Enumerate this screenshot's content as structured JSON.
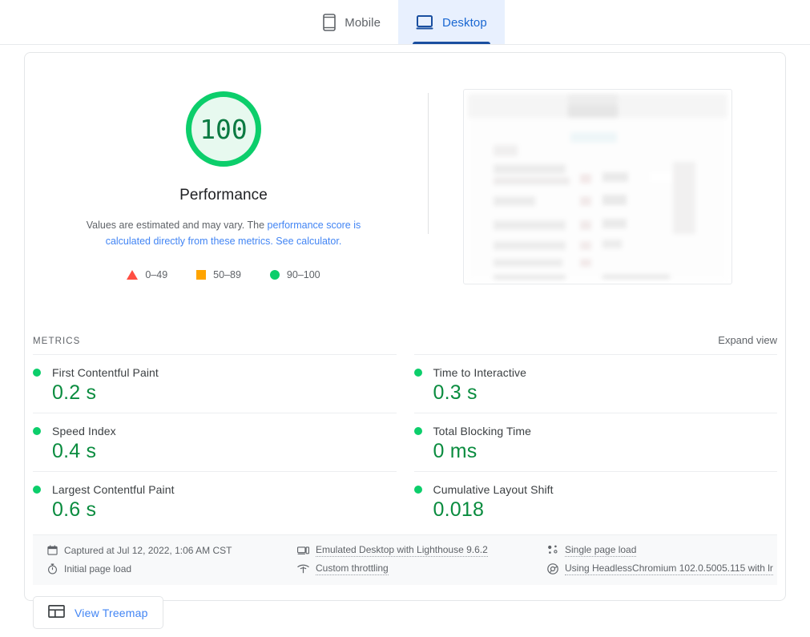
{
  "tabs": [
    {
      "id": "mobile",
      "label": "Mobile",
      "icon": "mobile-phone-icon",
      "active": false
    },
    {
      "id": "desktop",
      "label": "Desktop",
      "icon": "desktop-monitor-icon",
      "active": true
    }
  ],
  "score": {
    "value": "100",
    "title": "Performance",
    "ring_color": "#0cce6b",
    "fill_color": "#e7f9ef",
    "text_color": "#0b7a42",
    "description_before": "Values are estimated and may vary. The ",
    "link_1": "performance score is calculated directly from these metrics.",
    "link_2": "See calculator.",
    "link_color": "#4285f4"
  },
  "legend": [
    {
      "shape": "triangle",
      "color": "#ff4e42",
      "label": "0–49"
    },
    {
      "shape": "square",
      "color": "#ffa400",
      "label": "50–89"
    },
    {
      "shape": "circle",
      "color": "#0cce6b",
      "label": "90–100"
    }
  ],
  "metrics_section": {
    "heading": "METRICS",
    "expand_label": "Expand view"
  },
  "metrics": [
    {
      "name": "First Contentful Paint",
      "value": "0.2 s",
      "status": "pass",
      "color": "#0cce6b"
    },
    {
      "name": "Time to Interactive",
      "value": "0.3 s",
      "status": "pass",
      "color": "#0cce6b"
    },
    {
      "name": "Speed Index",
      "value": "0.4 s",
      "status": "pass",
      "color": "#0cce6b"
    },
    {
      "name": "Total Blocking Time",
      "value": "0 ms",
      "status": "pass",
      "color": "#0cce6b"
    },
    {
      "name": "Largest Contentful Paint",
      "value": "0.6 s",
      "status": "pass",
      "color": "#0cce6b"
    },
    {
      "name": "Cumulative Layout Shift",
      "value": "0.018",
      "status": "pass",
      "color": "#0cce6b"
    }
  ],
  "meta": {
    "captured": "Captured at Jul 12, 2022, 1:06 AM CST",
    "emulation": "Emulated Desktop with Lighthouse 9.6.2",
    "single_page_load": "Single page load",
    "initial_page_load": "Initial page load",
    "throttling": "Custom throttling",
    "user_agent": "Using HeadlessChromium 102.0.5005.115 with lr"
  },
  "treemap": {
    "label": "View Treemap",
    "icon": "treemap-icon"
  }
}
